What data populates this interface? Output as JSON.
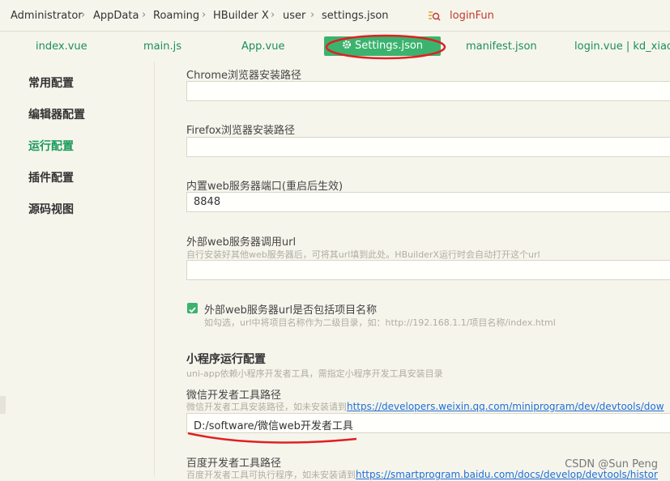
{
  "breadcrumb": [
    "Administrator",
    "AppData",
    "Roaming",
    "HBuilder X",
    "user",
    "settings.json"
  ],
  "search": {
    "text": "loginFun",
    "icon": "search-icon"
  },
  "tabs": [
    {
      "label": "index.vue"
    },
    {
      "label": "main.js"
    },
    {
      "label": "App.vue"
    },
    {
      "label": "Settings.json",
      "active": true
    },
    {
      "label": "manifest.json"
    },
    {
      "label": "login.vue | kd_xiaos"
    }
  ],
  "sidebar": [
    {
      "label": "常用配置"
    },
    {
      "label": "编辑器配置"
    },
    {
      "label": "运行配置",
      "active": true
    },
    {
      "label": "插件配置"
    },
    {
      "label": "源码视图"
    }
  ],
  "settings": {
    "chrome_label": "Chrome浏览器安装路径",
    "chrome_value": "",
    "firefox_label": "Firefox浏览器安装路径",
    "firefox_value": "",
    "port_label": "内置web服务器端口(重启后生效)",
    "port_value": "8848",
    "external_label": "外部web服务器调用url",
    "external_hint": "自行安装好其他web服务器后，可将其url填到此处。HBuilderX运行时会自动打开这个url",
    "external_value": "",
    "include_name_label": "外部web服务器url是否包括项目名称",
    "include_name_hint": "如勾选，url中将项目名称作为二级目录，如：http://192.168.1.1/项目名称/index.html",
    "include_name_checked": true,
    "mini_section": "小程序运行配置",
    "mini_hint": "uni-app依赖小程序开发者工具，需指定小程序开发工具安装目录",
    "wechat_label": "微信开发者工具路径",
    "wechat_hint": "微信开发者工具安装路径，如未安装请到",
    "wechat_link": "https://developers.weixin.qq.com/miniprogram/dev/devtools/dow",
    "wechat_value": "D:/software/微信web开发者工具",
    "baidu_label": "百度开发者工具路径",
    "baidu_hint": "百度开发者工具可执行程序，如未安装请到",
    "baidu_link": "https://smartprogram.baidu.com/docs/develop/devtools/histor"
  },
  "watermark": "CSDN @Sun  Peng",
  "colors": {
    "accent": "#3bb36e",
    "tab_text": "#1a8f5a",
    "annotation": "#e02020",
    "link": "#1e6fd9"
  }
}
